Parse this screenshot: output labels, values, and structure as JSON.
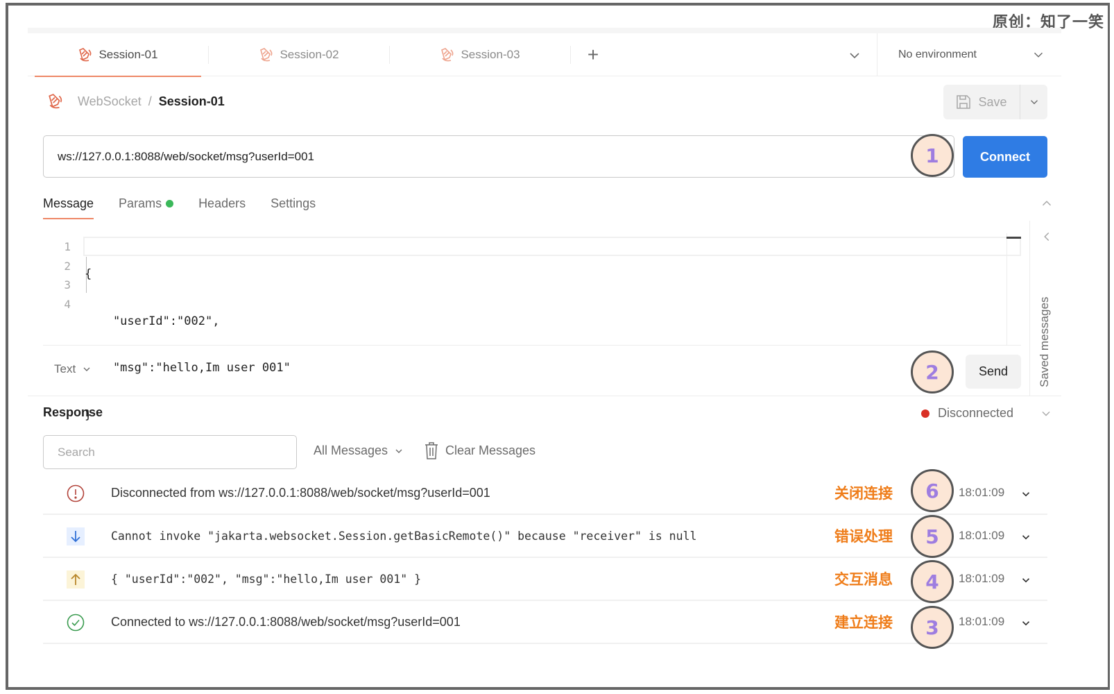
{
  "watermark": "原创：知了一笑",
  "tabs": [
    {
      "label": "Session-01",
      "active": true,
      "icon": "websocket-icon"
    },
    {
      "label": "Session-02",
      "active": false,
      "icon": "websocket-icon"
    },
    {
      "label": "Session-03",
      "active": false,
      "icon": "websocket-icon"
    }
  ],
  "tabbar": {
    "add_label": "+",
    "environment": "No environment"
  },
  "breadcrumb": {
    "parent": "WebSocket",
    "separator": "/",
    "current": "Session-01"
  },
  "toolbar": {
    "save_label": "Save"
  },
  "request": {
    "url": "ws://127.0.0.1:8088/web/socket/msg?userId=001",
    "connect_label": "Connect",
    "tabs": [
      {
        "label": "Message",
        "active": true
      },
      {
        "label": "Params",
        "active": false,
        "indicator": "green-dot"
      },
      {
        "label": "Headers",
        "active": false
      },
      {
        "label": "Settings",
        "active": false
      }
    ],
    "editor": {
      "line_numbers": [
        "1",
        "2",
        "3",
        "4"
      ],
      "lines": [
        "{",
        "    \"userId\":\"002\",",
        "    \"msg\":\"hello,Im user 001\"",
        "}"
      ]
    },
    "format": "Text",
    "send_label": "Send",
    "saved_messages_label": "Saved messages"
  },
  "response": {
    "title": "Response",
    "status": "Disconnected",
    "search_placeholder": "Search",
    "filter": "All Messages",
    "clear_label": "Clear Messages",
    "messages": [
      {
        "type": "disconnected",
        "icon": "alert-circle-icon",
        "text": "Disconnected from ws://127.0.0.1:8088/web/socket/msg?userId=001",
        "annotation": "关闭连接",
        "step": "6",
        "time": "18:01:09"
      },
      {
        "type": "received",
        "icon": "arrow-down-icon",
        "text": "Cannot invoke \"jakarta.websocket.Session.getBasicRemote()\" because \"receiver\" is null",
        "annotation": "错误处理",
        "step": "5",
        "time": "18:01:09"
      },
      {
        "type": "sent",
        "icon": "arrow-up-icon",
        "text": "{ \"userId\":\"002\", \"msg\":\"hello,Im user 001\" }",
        "annotation": "交互消息",
        "step": "4",
        "time": "18:01:09"
      },
      {
        "type": "connected",
        "icon": "check-circle-icon",
        "text": "Connected to ws://127.0.0.1:8088/web/socket/msg?userId=001",
        "annotation": "建立连接",
        "step": "3",
        "time": "18:01:09"
      }
    ]
  },
  "step_badges": {
    "url": "1",
    "send": "2"
  },
  "colors": {
    "accent": "#ee8766",
    "primary": "#2f7ce4",
    "connected": "#3a9b4f",
    "disconnected": "#d93025",
    "annotation": "#ef7d1a",
    "badge_fill": "#fce6d6",
    "badge_text": "#9e7de0"
  }
}
